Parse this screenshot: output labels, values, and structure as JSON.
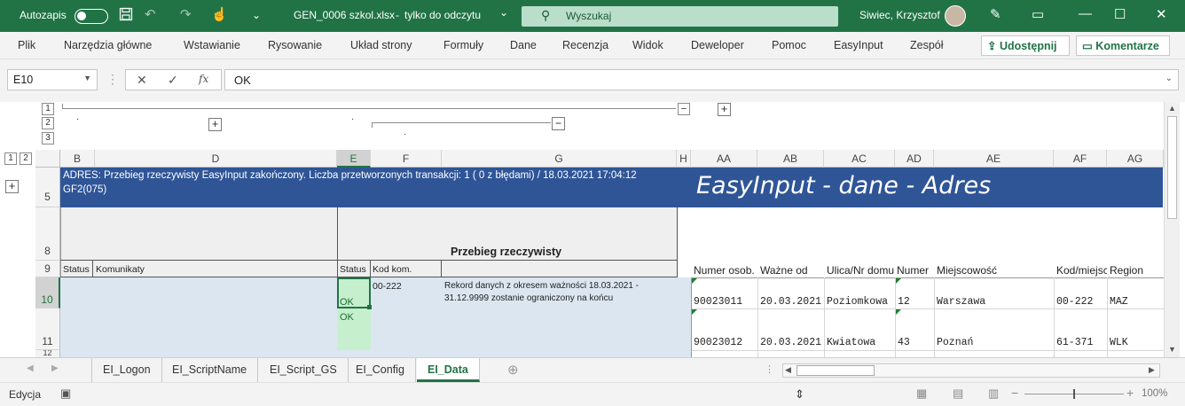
{
  "titlebar": {
    "autosave_label": "Autozapis",
    "file_name": "GEN_0006 szkol.xlsx",
    "separator": "-",
    "mode": "tylko do odczytu",
    "chevron": "⌄",
    "search_placeholder": "Wyszukaj",
    "user_name": "Siwiec, Krzysztof",
    "icons": [
      "save-icon",
      "undo-icon",
      "redo-icon",
      "touch-mode-icon",
      "customize-icon",
      "search-icon",
      "pen-icon",
      "ribbon-display-icon",
      "minimize-icon",
      "maximize-icon",
      "close-icon"
    ]
  },
  "ribbon": {
    "tabs": [
      "Plik",
      "Narzędzia główne",
      "Wstawianie",
      "Rysowanie",
      "Układ strony",
      "Formuły",
      "Dane",
      "Recenzja",
      "Widok",
      "Deweloper",
      "Pomoc",
      "EasyInput",
      "Zespół"
    ],
    "share_label": "Udostępnij",
    "comments_label": "Komentarze"
  },
  "formula_bar": {
    "name_box": "E10",
    "fx": "fx",
    "value": "OK"
  },
  "outline": {
    "levels": [
      "1",
      "2",
      "3"
    ],
    "row_levels": [
      "1",
      "2"
    ],
    "plus": "+",
    "minus": "−",
    "dot": "·"
  },
  "columns": [
    "B",
    "D",
    "E",
    "F",
    "G",
    "H",
    "AA",
    "AB",
    "AC",
    "AD",
    "AE",
    "AF",
    "AG"
  ],
  "rows": [
    "5",
    "8",
    "9",
    "10",
    "11",
    "12"
  ],
  "sheet": {
    "banner_text_line1": "ADRES: Przebieg rzeczywisty EasyInput zakończony. Liczba przetworzonych transakcji: 1 ( 0 z błędami) / 18.03.2021 17:04:12",
    "banner_text_line2": "GF2(075)",
    "banner_title": "EasyInput - dane - Adres",
    "section_header": "Przebieg rzeczywisty",
    "headers": {
      "status": "Status",
      "komunikaty": "Komunikaty",
      "status2": "Status",
      "kod_kom": "Kod kom.",
      "numer_osob": "Numer osob.",
      "wazne_od": "Ważne od",
      "ulica": "Ulica/Nr domu",
      "numer": "Numer",
      "miejscowosc": "Miejscowość",
      "kod_miejsc": "Kod/miejsc.",
      "region": "Region"
    },
    "row10": {
      "status": "OK",
      "kod": "00-222",
      "message_line1": "Rekord danych z okresem ważności 18.03.2021 -",
      "message_line2": "31.12.9999 zostanie ograniczony na końcu",
      "numer_osob": "90023011",
      "wazne_od": "20.03.2021",
      "ulica": "Poziomkowa",
      "numer": "12",
      "miejscowosc": "Warszawa",
      "region": "MAZ"
    },
    "row11": {
      "status": "OK",
      "numer_osob": "90023012",
      "wazne_od": "20.03.2021",
      "ulica": "Kwiatowa",
      "numer": "43",
      "miejscowosc": "Poznań",
      "kod": "61-371",
      "region": "WLK"
    },
    "colors": {
      "banner": "#2f5597",
      "light_blue": "#dce6f1",
      "light_green": "#c6efce",
      "excel_green": "#217346"
    }
  },
  "sheet_tabs": [
    "EI_Logon",
    "EI_ScriptName",
    "EI_Script_GS",
    "EI_Config",
    "EI_Data"
  ],
  "active_tab": "EI_Data",
  "status_bar": {
    "mode": "Edycja",
    "zoom": "100%"
  }
}
